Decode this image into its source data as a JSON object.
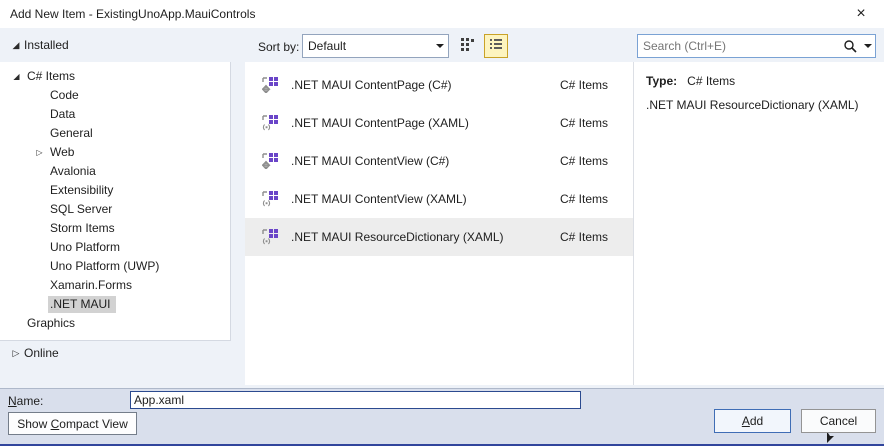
{
  "window": {
    "title": "Add New Item - ExistingUnoApp.MauiControls",
    "close_glyph": "×"
  },
  "toolbar": {
    "sort_label": "Sort by:",
    "sort_value": "Default",
    "search_placeholder": "Search (Ctrl+E)"
  },
  "sidebar": {
    "installed": {
      "label": "Installed",
      "glyph": "◢"
    },
    "online": {
      "label": "Online",
      "glyph": "▷"
    },
    "tree": [
      {
        "label": "C# Items",
        "glyph": "◢",
        "expanded": true
      },
      {
        "label": "Code"
      },
      {
        "label": "Data"
      },
      {
        "label": "General"
      },
      {
        "label": "Web",
        "glyph": "▷",
        "expanded": false
      },
      {
        "label": "Avalonia"
      },
      {
        "label": "Extensibility"
      },
      {
        "label": "SQL Server"
      },
      {
        "label": "Storm Items"
      },
      {
        "label": "Uno Platform"
      },
      {
        "label": "Uno Platform (UWP)"
      },
      {
        "label": "Xamarin.Forms"
      },
      {
        "label": ".NET MAUI",
        "selected": true
      },
      {
        "label": "Graphics"
      }
    ]
  },
  "list": {
    "items": [
      {
        "icon": "maui-contentpage-csharp-icon",
        "label": ".NET MAUI ContentPage (C#)",
        "category": "C# Items"
      },
      {
        "icon": "maui-contentpage-xaml-icon",
        "label": ".NET MAUI ContentPage (XAML)",
        "category": "C# Items"
      },
      {
        "icon": "maui-contentview-csharp-icon",
        "label": ".NET MAUI ContentView (C#)",
        "category": "C# Items"
      },
      {
        "icon": "maui-contentview-xaml-icon",
        "label": ".NET MAUI ContentView (XAML)",
        "category": "C# Items"
      },
      {
        "icon": "maui-resourcedictionary-xaml-icon",
        "label": ".NET MAUI ResourceDictionary (XAML)",
        "category": "C# Items",
        "selected": true
      }
    ]
  },
  "details": {
    "type_label": "Type:",
    "type_value": "C# Items",
    "description": ".NET MAUI ResourceDictionary (XAML)"
  },
  "footer": {
    "name_label": {
      "mnemonic": "N",
      "rest": "ame:"
    },
    "name_value": "App.xaml",
    "compact_button": {
      "pre": "Show ",
      "mnemonic": "C",
      "rest": "ompact View"
    },
    "add_button": {
      "mnemonic": "A",
      "rest": "dd"
    },
    "cancel_button": "Cancel"
  },
  "colors": {
    "tree_selection": "#d2d2d2",
    "list_selection": "#ededed",
    "active_toggle_bg": "#fdf4bf",
    "active_toggle_border": "#c9a227",
    "icon_purple": "#6a45c8",
    "bottom_border": "#31459c",
    "name_input_border": "#2b4a8f"
  }
}
